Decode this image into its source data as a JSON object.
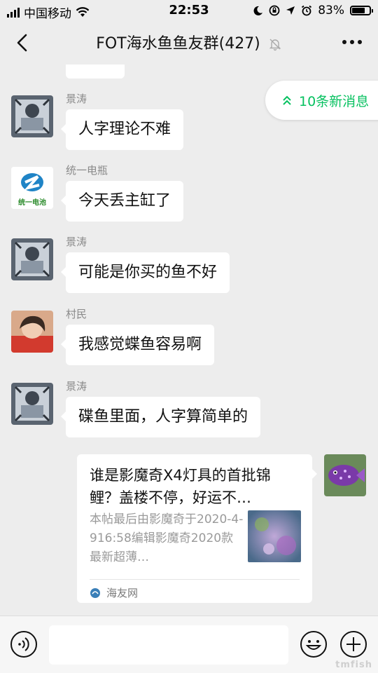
{
  "status_bar": {
    "carrier": "中国移动",
    "time": "22:53",
    "battery": "83%",
    "battery_level": 0.83
  },
  "header": {
    "title": "FOT海水鱼鱼友群(427)",
    "back_icon": "chevron-left-icon",
    "mute_icon": "bell-muted-icon",
    "more_icon": "more-dots-icon"
  },
  "new_messages": {
    "label": "10条新消息",
    "color": "#07c160"
  },
  "messages": [
    {
      "sender": "景涛",
      "text": "人字理论不难"
    },
    {
      "sender": "统一电瓶",
      "text": "今天丢主缸了",
      "avatar_text": "统一电池"
    },
    {
      "sender": "景涛",
      "text": "可能是你买的鱼不好"
    },
    {
      "sender": "村民",
      "text": "我感觉蝶鱼容易啊"
    },
    {
      "sender": "景涛",
      "text": "碟鱼里面，人字算简单的"
    }
  ],
  "link_card": {
    "title": "谁是影魔奇X4灯具的首批锦鲤？盖楼不停，好运不…",
    "description": "本帖最后由影魔奇于2020-4-916:58编辑影魔奇2020款最新超薄…",
    "source": "海友网"
  },
  "input_bar": {
    "voice_icon": "voice-icon",
    "emoji_icon": "emoji-icon",
    "plus_icon": "plus-icon",
    "watermark": "tmfish"
  }
}
